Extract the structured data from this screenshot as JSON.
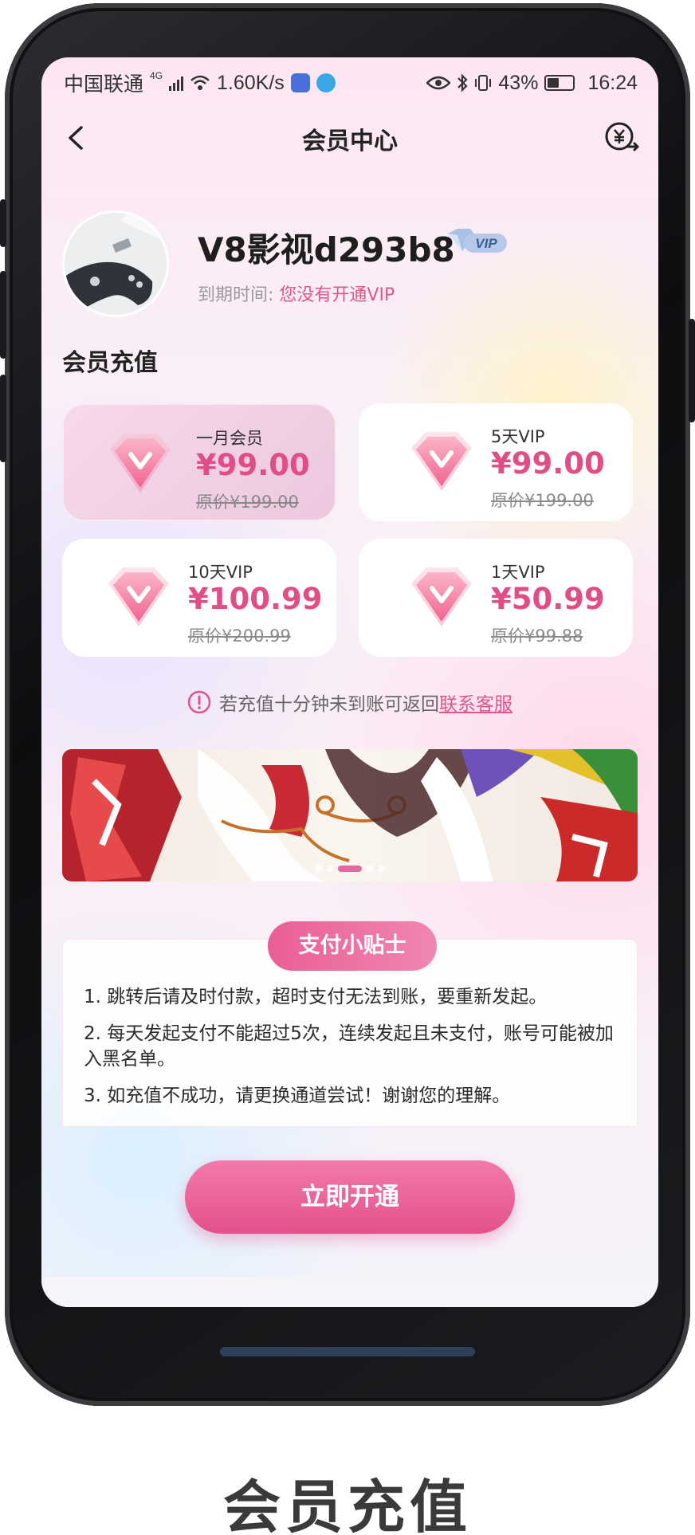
{
  "status_bar": {
    "carrier": "中国联通",
    "network": "4G",
    "speed": "1.60K/s",
    "battery": "43%",
    "time": "16:24"
  },
  "nav": {
    "title": "会员中心",
    "back_icon": "chevron-left-icon",
    "right_icon": "yuan-exchange-icon"
  },
  "profile": {
    "username": "V8影视d293b8",
    "badge": "VIP",
    "expire_label": "到期时间:",
    "expire_value": "您没有开通VIP"
  },
  "section_title": "会员充值",
  "plans": [
    {
      "name": "一月会员",
      "price": "¥99.00",
      "original": "原价¥199.00",
      "selected": true
    },
    {
      "name": "5天VIP",
      "price": "¥99.00",
      "original": "原价¥199.00",
      "selected": false
    },
    {
      "name": "10天VIP",
      "price": "¥100.99",
      "original": "原价¥200.99",
      "selected": false
    },
    {
      "name": "1天VIP",
      "price": "¥50.99",
      "original": "原价¥99.88",
      "selected": false
    }
  ],
  "notice": {
    "text": "若充值十分钟未到账可返回",
    "link": "联系客服"
  },
  "banner": {
    "page_count": 5,
    "active_index": 2
  },
  "tips": {
    "title": "支付小贴士",
    "items": [
      "1. 跳转后请及时付款，超时支付无法到账，要重新发起。",
      "2. 每天发起支付不能超过5次，连续发起且未支付，账号可能被加入黑名单。",
      "3. 如充值不成功，请更换通道尝试！谢谢您的理解。"
    ]
  },
  "cta": {
    "label": "立即开通"
  },
  "caption": "会员充值",
  "colors": {
    "accent": "#e14d86",
    "cta_top": "#f27aaa",
    "cta_bottom": "#e4508c"
  }
}
